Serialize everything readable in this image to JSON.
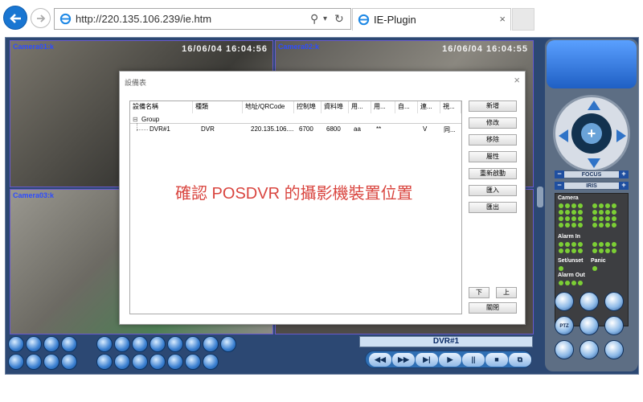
{
  "browser": {
    "url": "http://220.135.106.239/ie.htm",
    "tab_title": "IE-Plugin",
    "tab_close": "×",
    "search_icon": "search-icon",
    "refresh_icon": "refresh-icon"
  },
  "cameras": [
    {
      "label": "Camera01:k",
      "timestamp": "16/06/04 16:04:56"
    },
    {
      "label": "Camera02:k",
      "timestamp": "16/06/04 16:04:55"
    },
    {
      "label": "Camera03:k",
      "timestamp": ""
    },
    {
      "label": "",
      "timestamp": ""
    }
  ],
  "player": {
    "dvr_label": "DVR#1",
    "buttons": [
      "◀◀",
      "▶▶",
      "▶|",
      "▶",
      "||",
      "■",
      "⧉"
    ]
  },
  "ptz": {
    "focus_label": "FOCUS",
    "iris_label": "IRIS",
    "minus": "−",
    "plus": "+",
    "center": "+"
  },
  "status_panel": {
    "camera_label": "Camera",
    "alarm_in_label": "Alarm In",
    "set_unset_label": "Set/unset",
    "panic_label": "Panic",
    "alarm_out_label": "Alarm Out"
  },
  "right_buttons": [
    "",
    "",
    "",
    "PTZ",
    "",
    "",
    "",
    "",
    ""
  ],
  "dialog": {
    "title": "設備表",
    "close": "×",
    "columns": [
      "設備名稱",
      "種類",
      "地址/QRCode",
      "控制埠",
      "資料埠",
      "用...",
      "用...",
      "自...",
      "連...",
      "視..."
    ],
    "tree_group": "Group",
    "rows": [
      {
        "name": "DVR#1",
        "type": "DVR",
        "address": "220.135.106....",
        "control_port": "6700",
        "data_port": "6800",
        "user": "aa",
        "password": "**",
        "auto": "",
        "connect": "V",
        "video": "同..."
      }
    ],
    "overlay_text": "確認 POSDVR 的攝影機裝置位置",
    "buttons": [
      "新增",
      "修改",
      "移除",
      "屬性",
      "重新啟動",
      "匯入",
      "匯出"
    ],
    "down_label": "下",
    "up_label": "上",
    "close_label": "關閉"
  }
}
